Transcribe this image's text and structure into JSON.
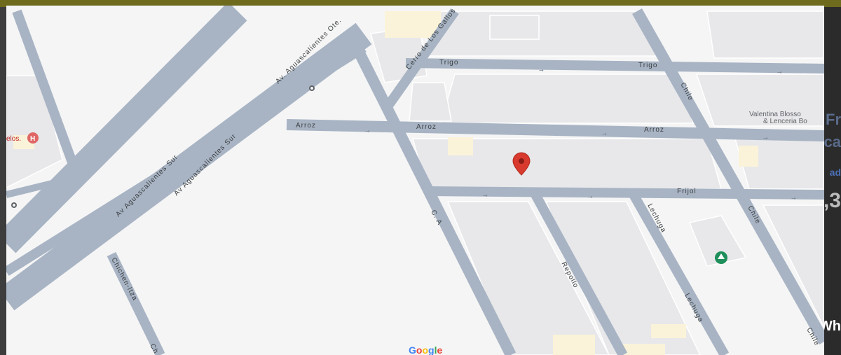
{
  "map": {
    "streets": {
      "trigo": "Trigo",
      "arroz": "Arroz",
      "frijol": "Frijol",
      "chile": "Chile",
      "lechuga": "Lechuga",
      "repollo": "Repollo",
      "c_a": "C. A",
      "cerro": "Cerro de Los Gallos",
      "av_ote": "Av. Aguascalientes Ote.",
      "av_sur": "Av Aguascalientes Sur",
      "chichen": "Chichen-Itza",
      "ch": "Ch"
    },
    "pois": {
      "valentina_line1": "Valentina Blosso",
      "valentina_line2": "& Lenceria Bo",
      "hospital_partial": "elos."
    },
    "attribution": "Google",
    "colors": {
      "road": "#a8b4c4",
      "block": "#e8e8ea",
      "land": "#f5f5f5",
      "pin": "#d93a2e",
      "park_pin": "#1e8e5a"
    }
  },
  "background": {
    "right_edge_fragments": [
      "Fr",
      "ca",
      "ad",
      ",3",
      "Wh"
    ]
  }
}
